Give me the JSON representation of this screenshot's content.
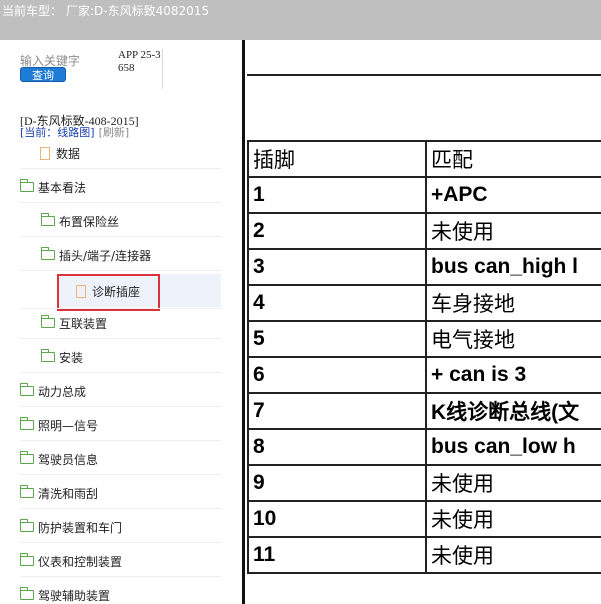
{
  "header": {
    "label": "当前车型：",
    "value": "厂家:D-东风标致4082015"
  },
  "sidebar": {
    "search_label": "输入关键字",
    "query_button": "查询",
    "app_code": "APP 25-3658",
    "car_model": "[D-东风标致-408-2015]",
    "current_label": "[当前：线路图]",
    "refresh_label": "[刷新]",
    "tree": [
      {
        "label": "数据",
        "type": "doc"
      },
      {
        "label": "基本看法",
        "type": "folder"
      },
      {
        "label": "布置保险丝",
        "type": "folder"
      },
      {
        "label": "插头/端子/连接器",
        "type": "folder"
      },
      {
        "label": "诊断插座",
        "type": "doc",
        "selected": true
      },
      {
        "label": "互联装置",
        "type": "folder"
      },
      {
        "label": "安装",
        "type": "folder"
      },
      {
        "label": "动力总成",
        "type": "folder"
      },
      {
        "label": "照明—信号",
        "type": "folder"
      },
      {
        "label": "驾驶员信息",
        "type": "folder"
      },
      {
        "label": "清洗和雨刮",
        "type": "folder"
      },
      {
        "label": "防护装置和车门",
        "type": "folder"
      },
      {
        "label": "仪表和控制装置",
        "type": "folder"
      },
      {
        "label": "驾驶辅助装置",
        "type": "folder"
      }
    ]
  },
  "table": {
    "headers": [
      "插脚",
      "匹配"
    ],
    "rows": [
      [
        "1",
        "+APC"
      ],
      [
        "2",
        "未使用"
      ],
      [
        "3",
        "bus can_high l"
      ],
      [
        "4",
        "车身接地"
      ],
      [
        "5",
        "电气接地"
      ],
      [
        "6",
        "+ can is 3"
      ],
      [
        "7",
        "K线诊断总线(文"
      ],
      [
        "8",
        "bus can_low h"
      ],
      [
        "9",
        "未使用"
      ],
      [
        "10",
        "未使用"
      ],
      [
        "11",
        "未使用"
      ]
    ]
  },
  "colors": {
    "accent": "#1e7bd6",
    "highlight": "#d9343d",
    "folder": "#5aa84a",
    "doc": "#f0b27a"
  }
}
